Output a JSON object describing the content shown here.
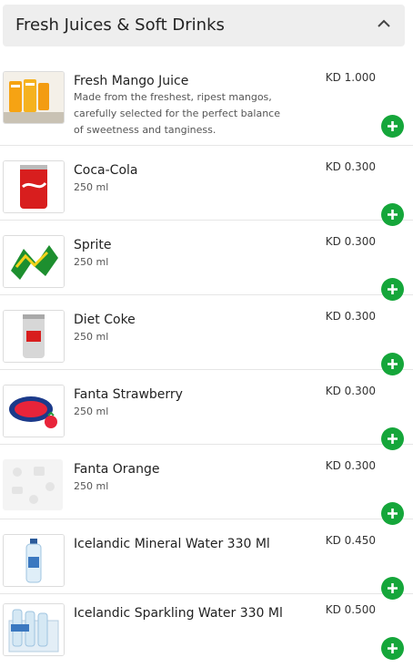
{
  "section": {
    "title": "Fresh Juices & Soft Drinks",
    "collapse_icon": "chevron-up-icon"
  },
  "items": [
    {
      "name": "Fresh Mango Juice",
      "description": "Made from the freshest, ripest mangos, carefully selected for the perfect balance of sweetness and tanginess.",
      "price": "KD 1.000",
      "image": "mango-juice-image"
    },
    {
      "name": "Coca-Cola",
      "size": "250 ml",
      "price": "KD 0.300",
      "image": "coca-cola-can-image"
    },
    {
      "name": "Sprite",
      "size": "250 ml",
      "price": "KD 0.300",
      "image": "sprite-logo-image"
    },
    {
      "name": "Diet Coke",
      "size": "250 ml",
      "price": "KD 0.300",
      "image": "diet-coke-can-image"
    },
    {
      "name": "Fanta Strawberry",
      "size": "250 ml",
      "price": "KD 0.300",
      "image": "fanta-strawberry-logo-image"
    },
    {
      "name": "Fanta Orange",
      "size": "250 ml",
      "price": "KD 0.300",
      "image": "placeholder-food-image"
    },
    {
      "name": "Icelandic Mineral Water 330 Ml",
      "price": "KD 0.450",
      "image": "water-bottle-image"
    },
    {
      "name": "Icelandic Sparkling Water 330 Ml",
      "price": "KD 0.500",
      "image": "water-pack-image"
    }
  ],
  "colors": {
    "accent": "#15a63a",
    "header_bg": "#eeeeee"
  }
}
